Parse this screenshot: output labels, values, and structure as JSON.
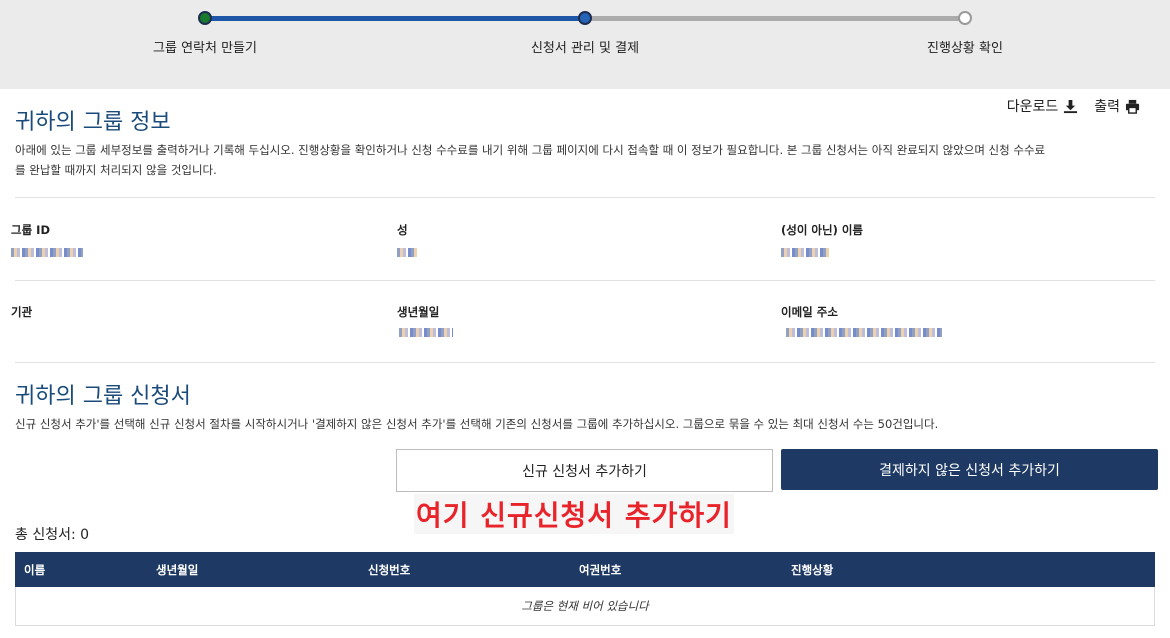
{
  "stepper": {
    "steps": [
      {
        "label": "그룹 연락처 만들기"
      },
      {
        "label": "신청서 관리 및 결제"
      },
      {
        "label": "진행상황 확인"
      }
    ]
  },
  "toolbar": {
    "download_label": "다운로드",
    "print_label": "출력"
  },
  "group_info": {
    "title": "귀하의 그룹 정보",
    "description": "아래에 있는 그룹 세부정보를 출력하거나 기록해 두십시오. 진행상황을 확인하거나 신청 수수료를 내기 위해 그룹 페이지에 다시 접속할 때 이 정보가 필요합니다. 본 그룹 신청서는 아직 완료되지 않았으며 신청 수수료",
    "description2": "를 완납할 때까지 처리되지 않을 것입니다.",
    "fields": {
      "group_id_label": "그룹 ID",
      "surname_label": "성",
      "given_name_label": "(성이 아닌) 이름",
      "org_label": "기관",
      "dob_label": "생년월일",
      "email_label": "이메일 주소"
    }
  },
  "applications": {
    "title": "귀하의 그룹 신청서",
    "description": "신규 신청서 추가'를 선택해 신규 신청서 절차를 시작하시거나 '결제하지 않은 신청서 추가'를 선택해 기존의 신청서를 그룹에 추가하십시오. 그룹으로 묶을 수 있는 최대 신청서 수는 50건입니다.",
    "add_new_label": "신규 신청서 추가하기",
    "add_unpaid_label": "결제하지 않은 신청서 추가하기",
    "annotation": "여기 신규신청서 추가하기",
    "total_label": "총 신청서: 0",
    "table": {
      "headers": [
        "이름",
        "생년월일",
        "신청번호",
        "여권번호",
        "진행상황"
      ],
      "empty_text": "그룹은 현재 비어 있습니다"
    }
  },
  "colors": {
    "accent": "#1e3a64",
    "heading": "#1b4b7a",
    "annotation": "#e8232a",
    "progress": "#1f57a8"
  }
}
